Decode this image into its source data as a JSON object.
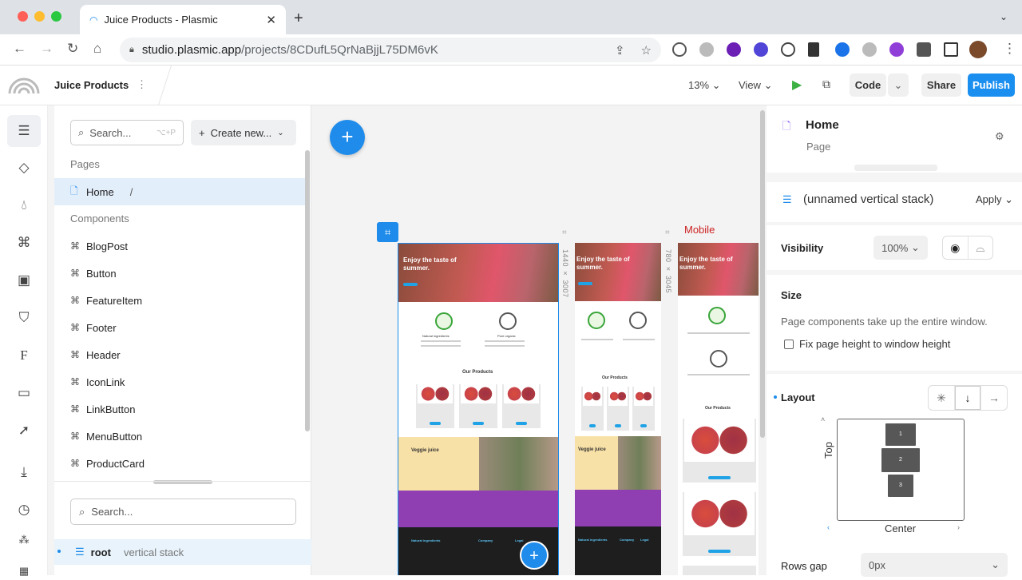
{
  "browser": {
    "tab_title": "Juice Products - Plasmic",
    "url_host": "studio.plasmic.app",
    "url_path": "/projects/8CDufL5QrNaBjjL75DM6vK",
    "traffic": [
      "#ff5f57",
      "#febc2e",
      "#28c840"
    ]
  },
  "topbar": {
    "project_name": "Juice Products",
    "zoom": "13%",
    "view_label": "View",
    "code_label": "Code",
    "share_label": "Share",
    "publish_label": "Publish"
  },
  "leftpanel": {
    "search_placeholder": "Search...",
    "search_shortcut": "⌥+P",
    "create_label": "Create new...",
    "pages_header": "Pages",
    "home_page": "Home",
    "home_path": "/",
    "components_header": "Components",
    "components": [
      "BlogPost",
      "Button",
      "FeatureItem",
      "Footer",
      "Header",
      "IconLink",
      "LinkButton",
      "MenuButton",
      "ProductCard"
    ],
    "tree_search_placeholder": "Search...",
    "tree_root_name": "root",
    "tree_root_type": "vertical stack"
  },
  "canvas": {
    "desktop_size": "1440 × 3007",
    "tablet_size": "780 × 3045",
    "mobile_label": "Mobile",
    "hero_text": "Enjoy the taste of summer.",
    "our_products": "Our Products",
    "veggie_juice": "Veggie juice",
    "natural": "Natural ingredients",
    "organic": "Pure organic",
    "footer_col1": "Natural ingredients",
    "footer_col2": "Company",
    "footer_col3": "Legal"
  },
  "rightpanel": {
    "page_name": "Home",
    "page_type": "Page",
    "element_name": "(unnamed vertical stack)",
    "apply_label": "Apply",
    "visibility_label": "Visibility",
    "visibility_value": "100%",
    "size_label": "Size",
    "size_help": "Page components take up the entire window.",
    "fix_height_label": "Fix page height to window height",
    "layout_label": "Layout",
    "top_label": "Top",
    "center_label": "Center",
    "rows_gap_label": "Rows gap",
    "rows_gap_value": "0px",
    "layout_items": [
      "1",
      "2",
      "3"
    ]
  },
  "colors": {
    "accent": "#1f8ceb",
    "publish": "#1a8ff0",
    "selection": "#e3eefb"
  }
}
